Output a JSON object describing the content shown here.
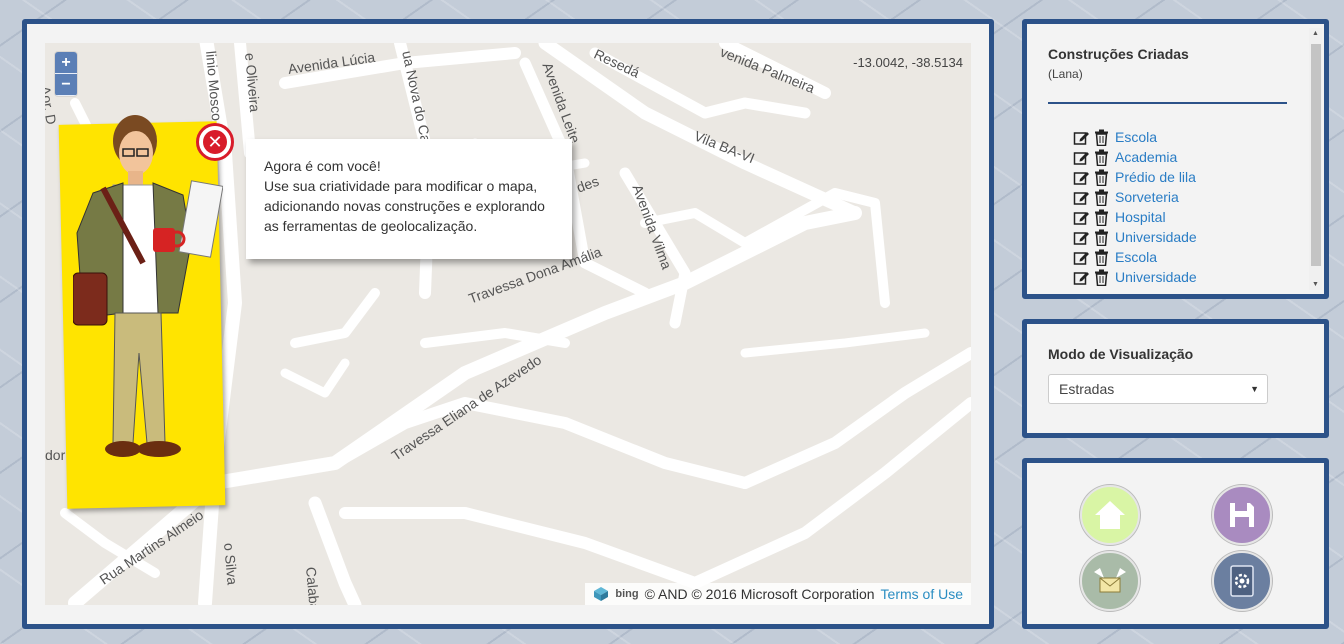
{
  "map": {
    "coordinates": "-13.0042, -38.5134",
    "zoom_in": "+",
    "zoom_out": "−",
    "attribution": {
      "provider": "bing",
      "copyright": "© AND © 2016 Microsoft Corporation",
      "terms": "Terms of Use"
    },
    "road_labels": [
      "Avenida Lúcia",
      "Resedá",
      "venida Palmeira",
      "Vila BA-VI",
      "Avenida Vilma",
      "Avenida Leite",
      "ua Nova do Cal",
      "e Oliveira",
      "linio Mosco",
      "Aor. D",
      "Travessa Dona Amália",
      "des",
      "Travessa Eliana de Azevedo",
      "Rua Martins Almeio",
      "o Silva",
      "Calabar",
      "dor"
    ]
  },
  "tutorial": {
    "close_icon": "close-icon",
    "lines": [
      "Agora é com você!",
      "Use sua criatividade para modificar o mapa,",
      "adicionando novas construções e explorando",
      "as ferramentas de geolocalização."
    ]
  },
  "constructions": {
    "title": "Construções Criadas",
    "subtitle": "(Lana)",
    "items": [
      {
        "label": "Escola"
      },
      {
        "label": "Academia"
      },
      {
        "label": "Prédio de lila"
      },
      {
        "label": "Sorveteria"
      },
      {
        "label": "Hospital"
      },
      {
        "label": "Universidade"
      },
      {
        "label": "Escola"
      },
      {
        "label": "Universidade"
      }
    ]
  },
  "view_mode": {
    "title": "Modo de Visualização",
    "selected": "Estradas"
  },
  "actions": {
    "home": {
      "icon": "home-icon",
      "color": "#d9f5a5"
    },
    "save": {
      "icon": "save-icon",
      "color": "#a98bc0"
    },
    "mail": {
      "icon": "mail-icon",
      "color": "#a9bba8"
    },
    "settings": {
      "icon": "settings-icon",
      "color": "#6b7fa0"
    }
  }
}
